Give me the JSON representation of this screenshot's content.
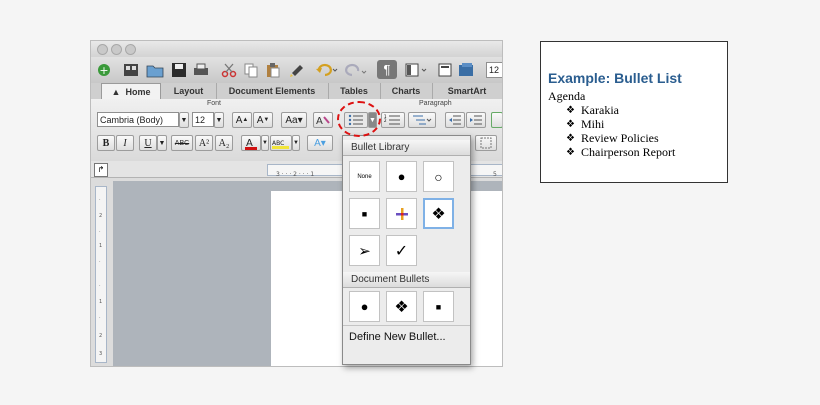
{
  "word": {
    "ribbon_tabs": [
      {
        "label": "Home",
        "active": true
      },
      {
        "label": "Layout",
        "active": false
      },
      {
        "label": "Document Elements",
        "active": false
      },
      {
        "label": "Tables",
        "active": false
      },
      {
        "label": "Charts",
        "active": false
      },
      {
        "label": "SmartArt",
        "active": false
      }
    ],
    "font_group_label": "Font",
    "paragraph_group_label": "Paragraph",
    "font_name": "Cambria (Body)",
    "font_size": "12",
    "toolbar_font_size": "12",
    "format_buttons": {
      "bold": "B",
      "italic": "I",
      "underline": "U",
      "strike": "ABC",
      "superscript": "A²",
      "subscript": "A₂"
    },
    "dropdown": {
      "bullet_library_label": "Bullet Library",
      "library": [
        {
          "symbol": "None",
          "icon": "none-bullet",
          "selected": false
        },
        {
          "symbol": "●",
          "icon": "filled-circle-bullet",
          "selected": false
        },
        {
          "symbol": "○",
          "icon": "hollow-circle-bullet",
          "selected": false
        },
        {
          "symbol": "■",
          "icon": "square-bullet",
          "selected": false
        },
        {
          "symbol": "✚",
          "icon": "color-cross-bullet",
          "selected": false
        },
        {
          "symbol": "❖",
          "icon": "diamond-bullet",
          "selected": true
        },
        {
          "symbol": "➢",
          "icon": "arrowhead-bullet",
          "selected": false
        },
        {
          "symbol": "✓",
          "icon": "checkmark-bullet",
          "selected": false
        }
      ],
      "document_bullets_label": "Document Bullets",
      "document_bullets": [
        {
          "symbol": "●",
          "icon": "filled-circle-bullet"
        },
        {
          "symbol": "❖",
          "icon": "diamond-bullet"
        },
        {
          "symbol": "■",
          "icon": "square-bullet"
        }
      ],
      "define_new": "Define New Bullet..."
    },
    "highlight_color": "#d11111"
  },
  "example": {
    "title": "Example:  Bullet List",
    "agenda": "Agenda",
    "items": [
      "Karakia",
      "Mihi",
      "Review Policies",
      "Chairperson Report"
    ],
    "bullet": "❖",
    "title_color": "#2a5d8f"
  }
}
